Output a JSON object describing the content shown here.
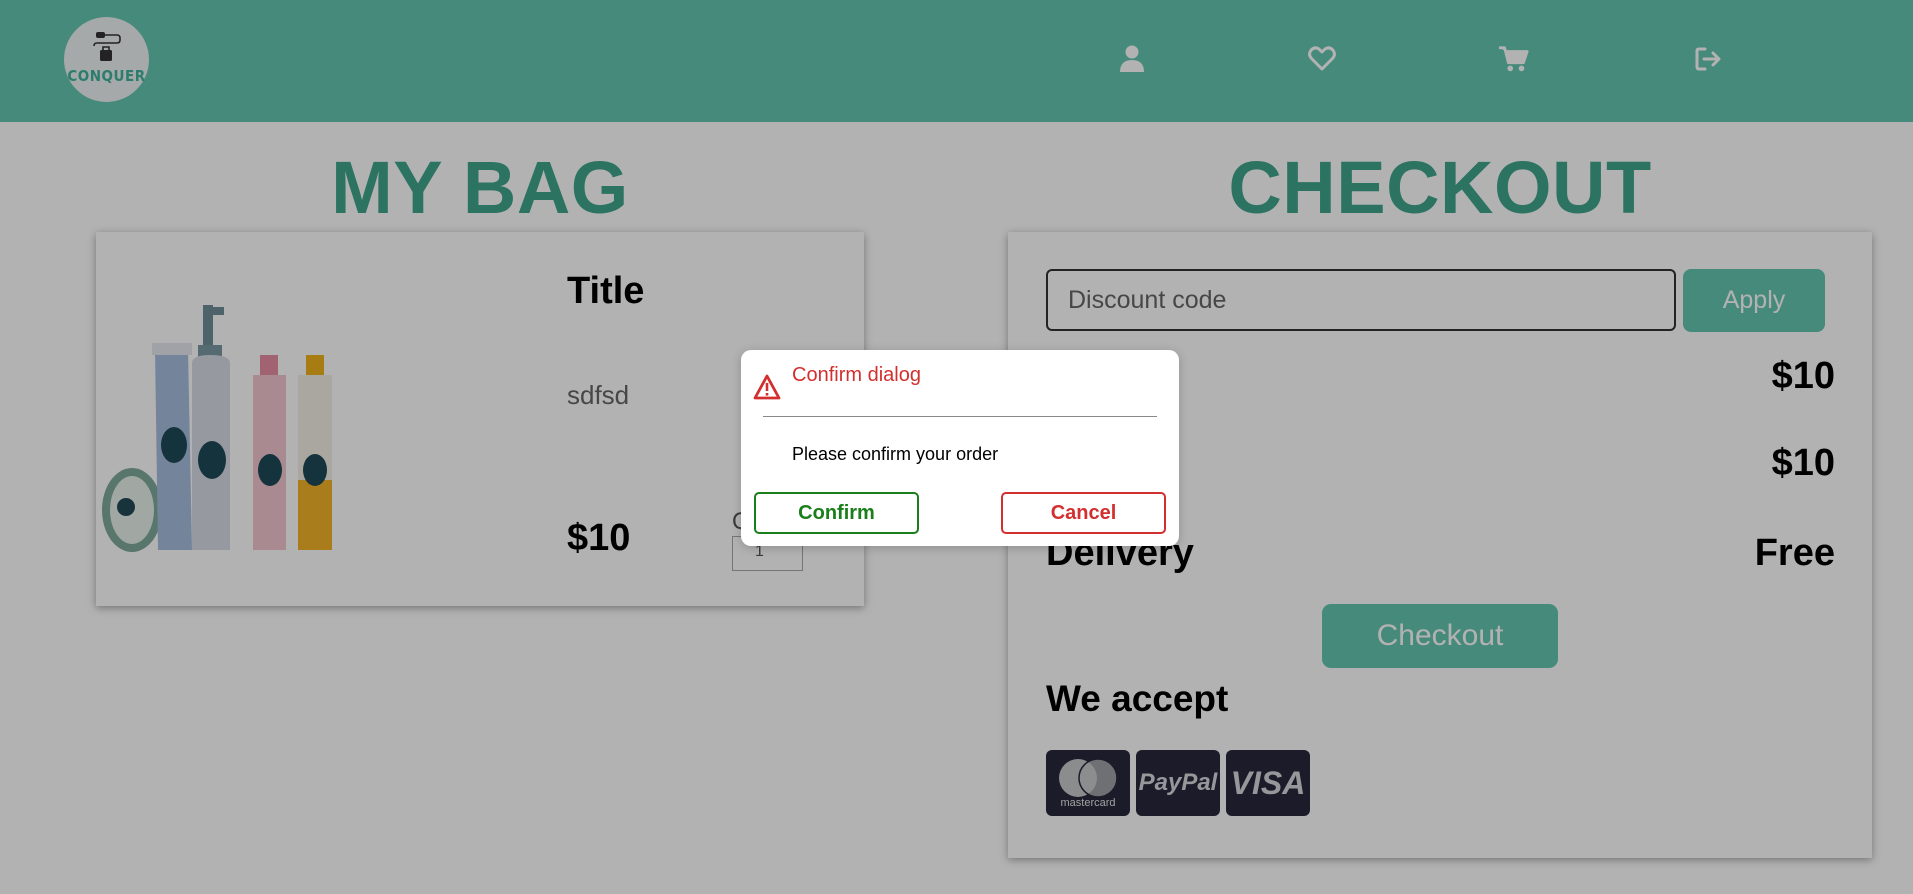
{
  "header": {
    "logo_text": "CONQUER",
    "icons": [
      "user-icon",
      "heart-icon",
      "cart-icon",
      "logout-icon"
    ]
  },
  "bag": {
    "heading": "MY BAG",
    "item": {
      "title": "Title",
      "description": "sdfsd",
      "price": "$10",
      "quantity_label": "Q",
      "quantity": "1"
    }
  },
  "checkout": {
    "heading": "CHECKOUT",
    "discount_placeholder": "Discount code",
    "apply_label": "Apply",
    "subtotal_value": "$10",
    "total_value": "$10",
    "delivery_label": "Delivery",
    "delivery_value": "Free",
    "checkout_label": "Checkout",
    "we_accept_label": "We accept",
    "payment_methods": {
      "mastercard": "mastercard",
      "paypal": "PayPal",
      "visa": "VISA"
    }
  },
  "dialog": {
    "title": "Confirm dialog",
    "message": "Please confirm your order",
    "confirm_label": "Confirm",
    "cancel_label": "Cancel"
  },
  "colors": {
    "header": "#65c6b2",
    "heading": "#3fa58d",
    "confirm": "#1a7f1a",
    "cancel": "#d32f2f",
    "payment_card": "#27283b"
  }
}
